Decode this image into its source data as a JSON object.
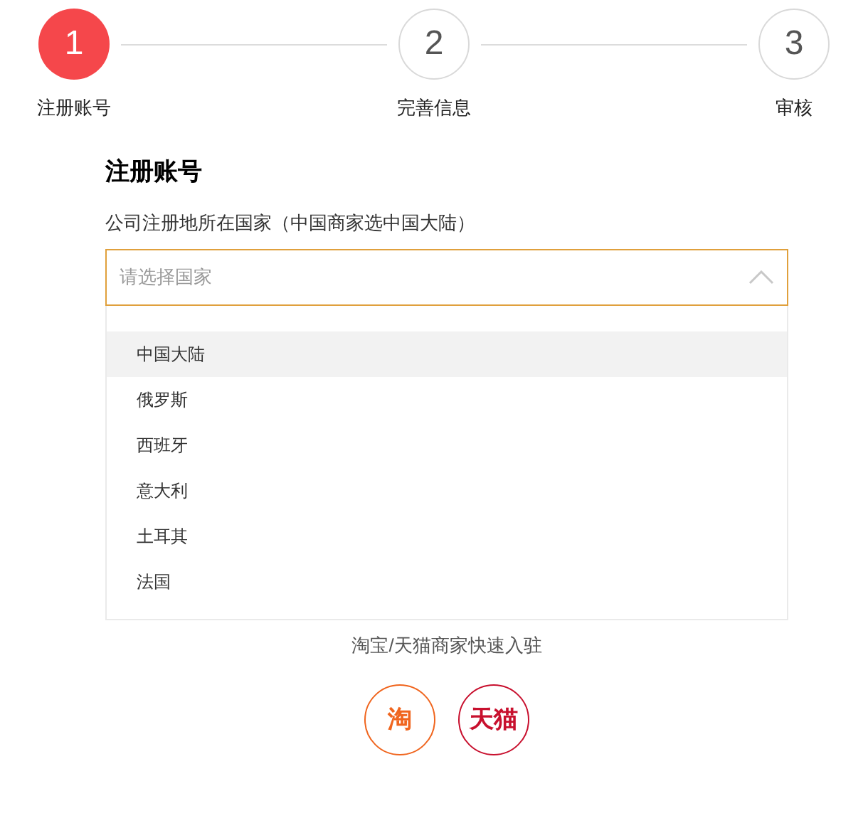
{
  "steps": [
    {
      "number": "1",
      "label": "注册账号",
      "selected": true
    },
    {
      "number": "2",
      "label": "完善信息",
      "selected": false
    },
    {
      "number": "3",
      "label": "审核",
      "selected": false
    }
  ],
  "form": {
    "title": "注册账号",
    "field_label": "公司注册地所在国家（中国商家选中国大陆）",
    "select": {
      "placeholder": "请选择国家",
      "expanded": true,
      "options": [
        {
          "label": "中国大陆",
          "selected": true
        },
        {
          "label": "俄罗斯",
          "selected": false
        },
        {
          "label": "西班牙",
          "selected": false
        },
        {
          "label": "意大利",
          "selected": false
        },
        {
          "label": "土耳其",
          "selected": false
        },
        {
          "label": "法国",
          "selected": false
        }
      ]
    }
  },
  "quick_entry": {
    "caption": "淘宝/天猫商家快速入驻",
    "logos": [
      {
        "text": "淘",
        "color": "#f0651e"
      },
      {
        "text": "天猫",
        "color": "#c8102e"
      }
    ]
  }
}
